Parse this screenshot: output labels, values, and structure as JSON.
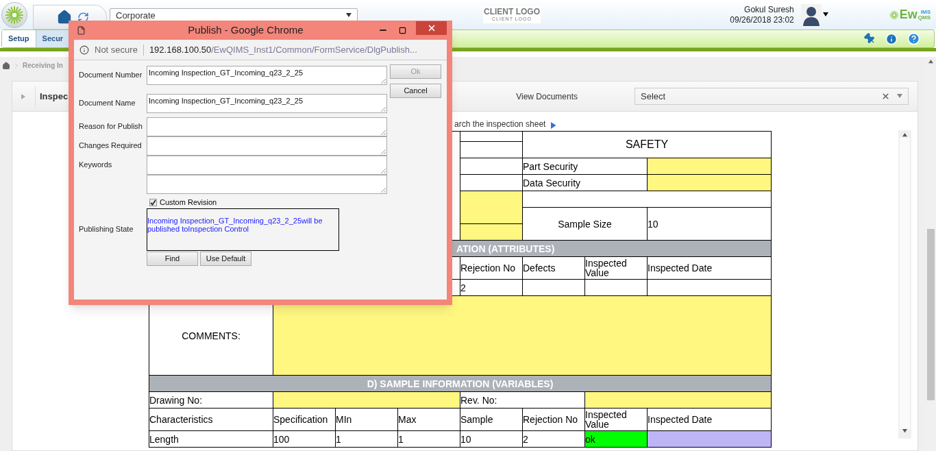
{
  "header": {
    "company": "Corporate",
    "client_logo": {
      "main": "CLIENT LOGO",
      "sub": "CLIENT LOGO"
    },
    "user": {
      "name": "Gokul Suresh",
      "datetime": "09/26/2018 23:02"
    },
    "brand": {
      "main": "Ew",
      "top": "IMS",
      "bottom": "QMS"
    }
  },
  "menu": [
    {
      "label": "Setup",
      "selected": true
    },
    {
      "label": "Secur",
      "selected": false
    }
  ],
  "breadcrumb": [
    "Receiving In"
  ],
  "panel": {
    "title": "Inspec",
    "view_label": "View Documents",
    "select": {
      "value": "Select"
    },
    "link": "arch the inspection sheet"
  },
  "sheet": {
    "heading": "SAFETY",
    "security_rows": [
      {
        "label": "Part Security"
      },
      {
        "label": "Data Security"
      }
    ],
    "sample_size": {
      "label": "Sample Size",
      "value": "10"
    },
    "attributes": {
      "header": "ATION (ATTRIBUTES)",
      "columns": [
        "Rejection No",
        "Defects",
        "Inspected Value",
        "Inspected Date"
      ],
      "row": [
        "2"
      ]
    },
    "comments_label": "COMMENTS:",
    "variables": {
      "header": "D) SAMPLE INFORMATION (VARIABLES)",
      "drawing_label": "Drawing No:",
      "rev_label": "Rev. No:",
      "columns": [
        "Characteristics",
        "Specification",
        "MIn",
        "Max",
        "Sample",
        "Rejection No",
        "Inspected Value",
        "Inspected Date"
      ],
      "rows": [
        {
          "cells": [
            "Length",
            "100",
            "1",
            "1",
            "10",
            "2",
            "ok",
            ""
          ]
        }
      ]
    }
  },
  "dialog": {
    "title": "Publish - Google Chrome",
    "address": {
      "security": "Not secure",
      "host": "192.168.100.50",
      "path": "/EwQIMS_Inst1/Common/FormService/DlgPublish..."
    },
    "fields": [
      {
        "kind": "text",
        "label": "Document Number",
        "value": "Incoming Inspection_GT_Incoming_q23_2_25"
      },
      {
        "kind": "text",
        "label": "Document Name",
        "value": "Incoming Inspection_GT_Incoming_q23_2_25"
      },
      {
        "kind": "text",
        "label": "Reason for Publish"
      },
      {
        "kind": "text",
        "label": "Changes Required"
      },
      {
        "kind": "text",
        "label": "Keywords"
      },
      {
        "kind": "blank"
      }
    ],
    "checkbox": {
      "label": "Custom Revision",
      "checked": true
    },
    "publishing_state": {
      "label": "Publishing State",
      "message": "Incoming Inspection_GT_Incoming_q23_2_25will be published toInspection Control"
    },
    "buttons": [
      {
        "label": "Ok",
        "disabled": true
      },
      {
        "label": "Cancel",
        "disabled": false
      }
    ],
    "state_buttons": [
      "Find",
      "Use Default"
    ]
  }
}
